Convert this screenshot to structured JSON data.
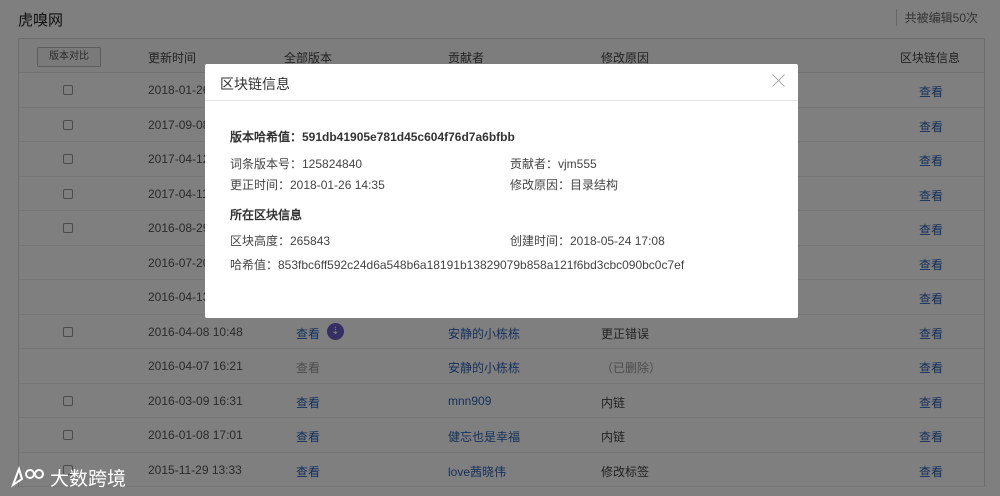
{
  "header": {
    "site_title": "虎嗅网",
    "edit_count": "共被编辑50次"
  },
  "table": {
    "compare_button": "版本对比",
    "columns": [
      "更新时间",
      "全部版本",
      "贡献者",
      "修改原因",
      "区块链信息"
    ],
    "rows": [
      {
        "time": "2018-01-26",
        "version": "",
        "user": "",
        "reason": "",
        "chain": "查看"
      },
      {
        "time": "2017-09-08",
        "version": "",
        "user": "",
        "reason": "",
        "chain": "查看"
      },
      {
        "time": "2017-04-12",
        "version": "",
        "user": "",
        "reason": "",
        "chain": "查看"
      },
      {
        "time": "2017-04-11",
        "version": "",
        "user": "",
        "reason": "",
        "chain": "查看"
      },
      {
        "time": "2016-08-29",
        "version": "",
        "user": "",
        "reason": "",
        "chain": "查看"
      },
      {
        "time": "2016-07-20",
        "version": "",
        "user": "",
        "reason": "",
        "chain": "查看"
      },
      {
        "time": "2016-04-13",
        "version": "",
        "user": "",
        "reason": "",
        "chain": "查看"
      },
      {
        "time": "2016-04-08 10:48",
        "version": "查看",
        "user": "安静的小栋栋",
        "reason": "更正错误",
        "chain": "查看"
      },
      {
        "time": "2016-04-07 16:21",
        "version": "查看",
        "user": "安静的小栋栋",
        "reason": "（已删除）",
        "chain": "查看"
      },
      {
        "time": "2016-03-09 16:31",
        "version": "查看",
        "user": "mnn909",
        "reason": "内链",
        "chain": "查看"
      },
      {
        "time": "2016-01-08 17:01",
        "version": "查看",
        "user": "健忘也是幸福",
        "reason": "内链",
        "chain": "查看"
      },
      {
        "time": "2015-11-29 13:33",
        "version": "查看",
        "user": "love茜晓伟",
        "reason": "修改标签",
        "chain": "查看"
      }
    ]
  },
  "modal": {
    "title": "区块链信息",
    "version_hash": "版本哈希值：591db41905e781d45c604f76d7a6bfbb",
    "entry_version": "词条版本号：125824840",
    "contributor": "贡献者：vjm555",
    "update_time": "更正时间：2018-01-26 14:35",
    "reason": "修改原因：目录结构",
    "block_section": "所在区块信息",
    "block_height": "区块高度：265843",
    "created_time": "创建时间：2018-05-24 17:08",
    "hash": "哈希值：853fbc6ff592c24d6a548b6a18191b13829079b858a121f6bd3cbc090bc0c7ef"
  },
  "watermark": {
    "text": "大数跨境"
  },
  "colors": {
    "link": "#2a63b8",
    "badge": "#6b5fc7",
    "overlay": "rgba(0,0,0,0.5)"
  }
}
